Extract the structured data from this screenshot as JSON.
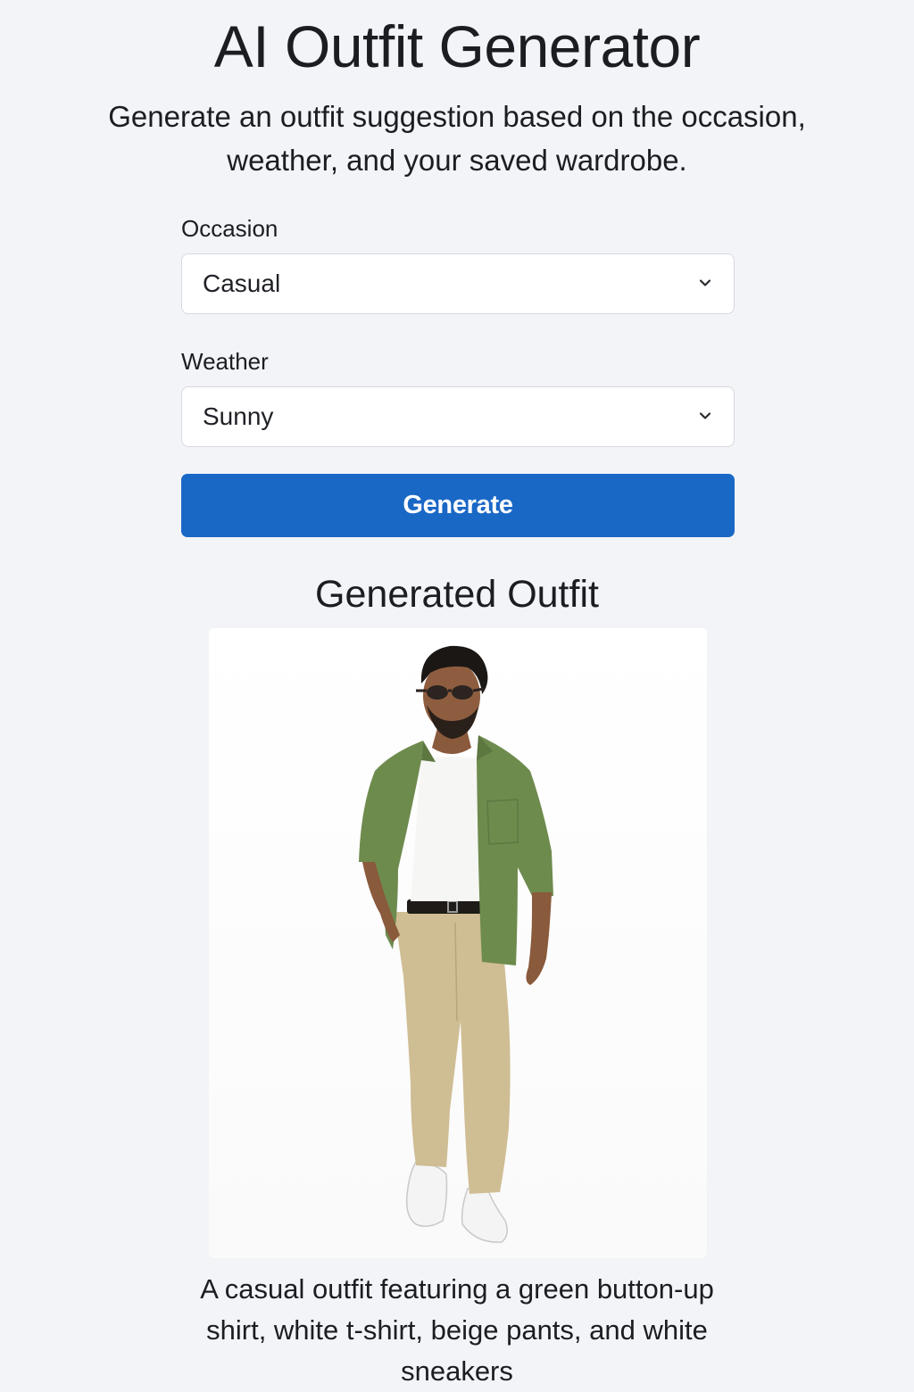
{
  "header": {
    "title": "AI Outfit Generator",
    "subtitle": "Generate an outfit suggestion based on the occasion, weather, and your saved wardrobe."
  },
  "form": {
    "occasion": {
      "label": "Occasion",
      "selected": "Casual"
    },
    "weather": {
      "label": "Weather",
      "selected": "Sunny"
    },
    "generate_label": "Generate"
  },
  "result": {
    "heading": "Generated Outfit",
    "description": "A casual outfit featuring a green button-up shirt, white t-shirt, beige pants, and white sneakers"
  },
  "colors": {
    "background": "#f3f4f8",
    "accent": "#1a68c6",
    "shirt": "#6e8b4e",
    "tshirt": "#f6f6f4",
    "pants": "#cfbd93",
    "sneakers": "#f4f4f4"
  }
}
